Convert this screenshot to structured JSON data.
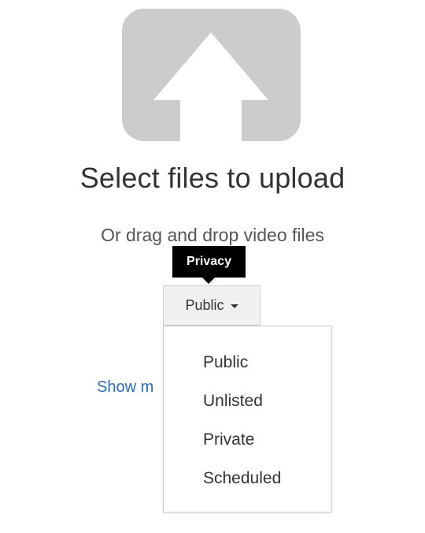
{
  "upload": {
    "icon": "upload-arrow-icon",
    "icon_color": "#cccccc",
    "title": "Select files to upload",
    "subtitle": "Or drag and drop video files"
  },
  "privacy": {
    "tooltip": "Privacy",
    "selected": "Public",
    "caret_icon": "caret-down-icon",
    "options": [
      "Public",
      "Unlisted",
      "Private",
      "Scheduled"
    ]
  },
  "show_more": {
    "label": "Show m",
    "color": "#2a6ebb"
  }
}
